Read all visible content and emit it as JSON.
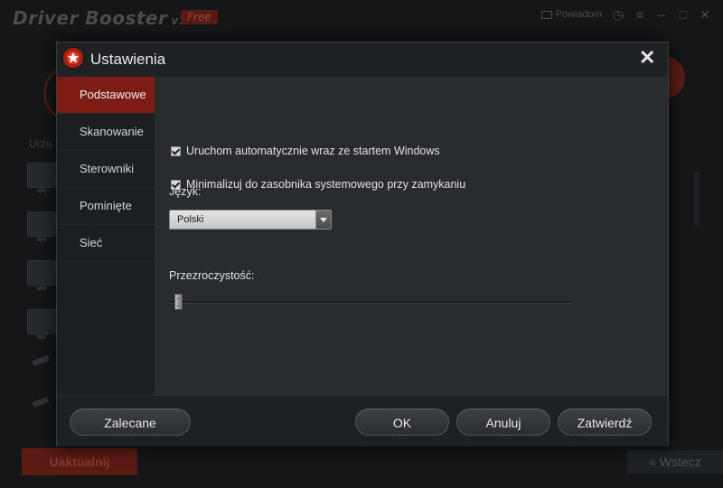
{
  "background": {
    "app_title": "Driver Booster",
    "app_version": "v1.0",
    "badge": "Free",
    "feedback_label": "Powiadom",
    "section_label": "Urzą",
    "update_button": "Uaktualnij",
    "back_button": "Wstecz"
  },
  "dialog": {
    "title": "Ustawienia",
    "sidebar": [
      {
        "label": "Podstawowe",
        "active": true
      },
      {
        "label": "Skanowanie",
        "active": false
      },
      {
        "label": "Sterowniki",
        "active": false
      },
      {
        "label": "Pominięte",
        "active": false
      },
      {
        "label": "Sieć",
        "active": false
      }
    ],
    "options": {
      "autostart": {
        "label": "Uruchom automatycznie wraz ze startem Windows",
        "checked": true
      },
      "minimize_tray": {
        "label": "Minimalizuj do zasobnika systemowego przy zamykaniu",
        "checked": true
      }
    },
    "language": {
      "label": "Język:",
      "selected": "Polski"
    },
    "transparency": {
      "label": "Przezroczystość:",
      "value": 0
    },
    "buttons": {
      "recommended": "Zalecane",
      "ok": "OK",
      "cancel": "Anuluj",
      "apply": "Zatwierdź"
    }
  },
  "colors": {
    "accent": "#7c1c14",
    "background": "#151617",
    "dialog": "#232628"
  }
}
